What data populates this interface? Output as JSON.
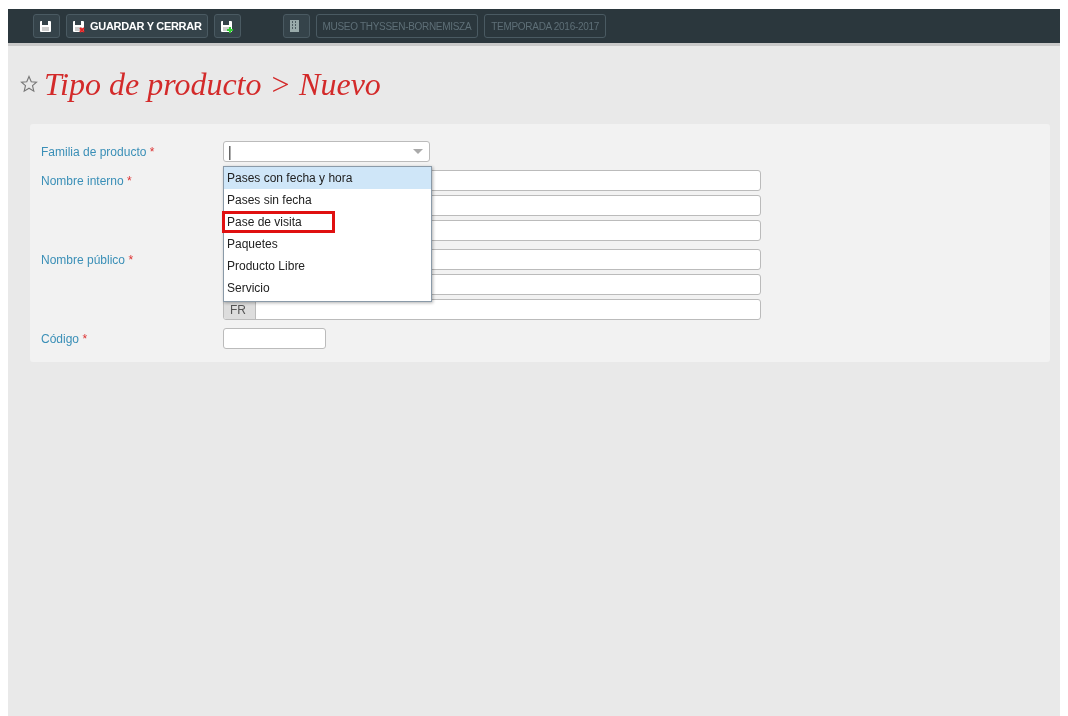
{
  "toolbar": {
    "buttons": [
      {
        "kind": "save"
      },
      {
        "kind": "save-close",
        "label": "GUARDAR Y CERRAR"
      },
      {
        "kind": "save-new"
      }
    ],
    "venue": "MUSEO THYSSEN-BORNEMISZA",
    "season": "TEMPORADA 2016-2017"
  },
  "page": {
    "title": "Tipo de producto > Nuevo",
    "favorite": false
  },
  "form": {
    "fields": [
      {
        "label": "Familia de producto",
        "required_mark": "*",
        "inputs": [
          {
            "kind": "combo",
            "value": "|"
          }
        ]
      },
      {
        "label": "Nombre interno",
        "required_mark": "*",
        "inputs": [
          {
            "kind": "text"
          },
          {
            "kind": "text"
          },
          {
            "kind": "text"
          }
        ]
      },
      {
        "label": "Nombre público",
        "required_mark": "*",
        "inputs": [
          {
            "kind": "text"
          },
          {
            "kind": "text"
          },
          {
            "kind": "prefixed",
            "prefix": "FR"
          }
        ]
      },
      {
        "label": "Código",
        "required_mark": "*",
        "inputs": [
          {
            "kind": "short"
          }
        ]
      }
    ]
  },
  "dropdown": {
    "options": [
      {
        "label": "Pases con fecha y hora",
        "selected": true,
        "annotated": false
      },
      {
        "label": "Pases sin fecha",
        "selected": false,
        "annotated": false
      },
      {
        "label": "Pase de visita",
        "selected": false,
        "annotated": true
      },
      {
        "label": "Paquetes",
        "selected": false,
        "annotated": false
      },
      {
        "label": "Producto Libre",
        "selected": false,
        "annotated": false
      },
      {
        "label": "Servicio",
        "selected": false,
        "annotated": false
      }
    ]
  }
}
